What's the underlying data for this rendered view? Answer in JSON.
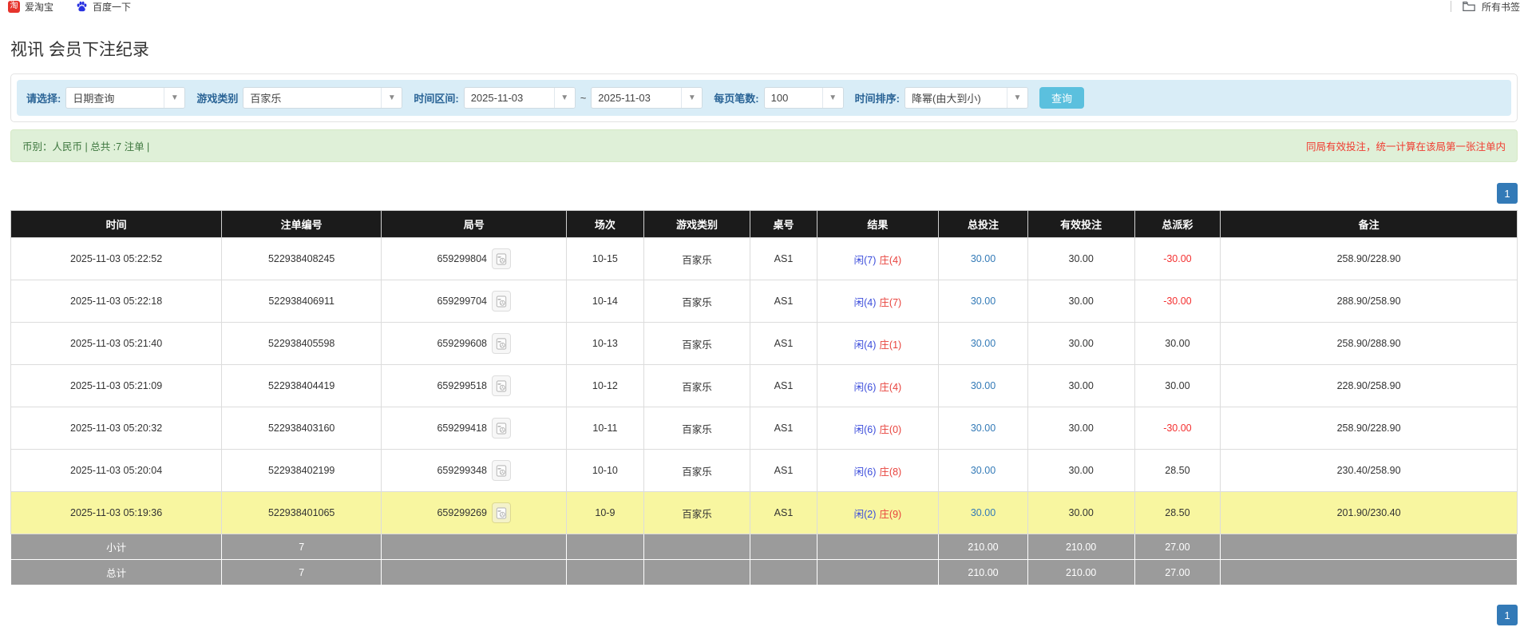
{
  "colors": {
    "header_bg": "#1b1b1b",
    "highlight_yellow": "#f8f6a0",
    "summary_gray": "#9b9b9b",
    "link_blue": "#337ab7",
    "player_blue": "#3b4cdb",
    "banker_red": "#e8423c",
    "neg_red": "#f43030",
    "alert_green_bg": "#dff0d8",
    "alert_green_text": "#3c763d",
    "alert_red_text": "#f03b30",
    "filter_bg": "#d9edf7",
    "filter_label": "#2a6496",
    "query_btn": "#5bc0de",
    "page_btn": "#337ab7"
  },
  "browser": {
    "bookmarks": [
      {
        "label": "爱淘宝",
        "icon": "taobao-icon",
        "icon_glyph": "淘"
      },
      {
        "label": "百度一下",
        "icon": "baidu-icon"
      }
    ],
    "all_bookmarks": "所有书签"
  },
  "page": {
    "title": "视讯 会员下注纪录"
  },
  "filters": {
    "select_label": "请选择:",
    "select_value": "日期查询",
    "game_label": "游戏类别",
    "game_value": "百家乐",
    "range_label": "时间区间:",
    "date_from": "2025-11-03",
    "tilde": "~",
    "date_to": "2025-11-03",
    "page_size_label": "每页笔数:",
    "page_size_value": "100",
    "sort_label": "时间排序:",
    "sort_value": "降幂(由大到小)",
    "query_button": "查询"
  },
  "summary_bar": {
    "left": "币别：人民币 | 总共 :7 注单 |",
    "right": "同局有效投注，统一计算在该局第一张注单内"
  },
  "pagination": {
    "current_page": "1"
  },
  "table": {
    "headers": [
      "时间",
      "注单编号",
      "局号",
      "场次",
      "游戏类别",
      "桌号",
      "结果",
      "总投注",
      "有效投注",
      "总派彩",
      "备注"
    ],
    "rows": [
      {
        "time": "2025-11-03 05:22:52",
        "bet_id": "522938408245",
        "round_id": "659299804",
        "session": "10-15",
        "game": "百家乐",
        "table": "AS1",
        "result_player": "闲(7)",
        "result_banker": "庄(4)",
        "total_bet": "30.00",
        "valid_bet": "30.00",
        "payout": "-30.00",
        "note": "258.90/228.90",
        "highlight": false
      },
      {
        "time": "2025-11-03 05:22:18",
        "bet_id": "522938406911",
        "round_id": "659299704",
        "session": "10-14",
        "game": "百家乐",
        "table": "AS1",
        "result_player": "闲(4)",
        "result_banker": "庄(7)",
        "total_bet": "30.00",
        "valid_bet": "30.00",
        "payout": "-30.00",
        "note": "288.90/258.90",
        "highlight": false
      },
      {
        "time": "2025-11-03 05:21:40",
        "bet_id": "522938405598",
        "round_id": "659299608",
        "session": "10-13",
        "game": "百家乐",
        "table": "AS1",
        "result_player": "闲(4)",
        "result_banker": "庄(1)",
        "total_bet": "30.00",
        "valid_bet": "30.00",
        "payout": "30.00",
        "note": "258.90/288.90",
        "highlight": false
      },
      {
        "time": "2025-11-03 05:21:09",
        "bet_id": "522938404419",
        "round_id": "659299518",
        "session": "10-12",
        "game": "百家乐",
        "table": "AS1",
        "result_player": "闲(6)",
        "result_banker": "庄(4)",
        "total_bet": "30.00",
        "valid_bet": "30.00",
        "payout": "30.00",
        "note": "228.90/258.90",
        "highlight": false
      },
      {
        "time": "2025-11-03 05:20:32",
        "bet_id": "522938403160",
        "round_id": "659299418",
        "session": "10-11",
        "game": "百家乐",
        "table": "AS1",
        "result_player": "闲(6)",
        "result_banker": "庄(0)",
        "total_bet": "30.00",
        "valid_bet": "30.00",
        "payout": "-30.00",
        "note": "258.90/228.90",
        "highlight": false
      },
      {
        "time": "2025-11-03 05:20:04",
        "bet_id": "522938402199",
        "round_id": "659299348",
        "session": "10-10",
        "game": "百家乐",
        "table": "AS1",
        "result_player": "闲(6)",
        "result_banker": "庄(8)",
        "total_bet": "30.00",
        "valid_bet": "30.00",
        "payout": "28.50",
        "note": "230.40/258.90",
        "highlight": false
      },
      {
        "time": "2025-11-03 05:19:36",
        "bet_id": "522938401065",
        "round_id": "659299269",
        "session": "10-9",
        "game": "百家乐",
        "table": "AS1",
        "result_player": "闲(2)",
        "result_banker": "庄(9)",
        "total_bet": "30.00",
        "valid_bet": "30.00",
        "payout": "28.50",
        "note": "201.90/230.40",
        "highlight": true
      }
    ],
    "subtotal": {
      "label": "小计",
      "count": "7",
      "total_bet": "210.00",
      "valid_bet": "210.00",
      "payout": "27.00"
    },
    "total": {
      "label": "总计",
      "count": "7",
      "total_bet": "210.00",
      "valid_bet": "210.00",
      "payout": "27.00"
    }
  }
}
